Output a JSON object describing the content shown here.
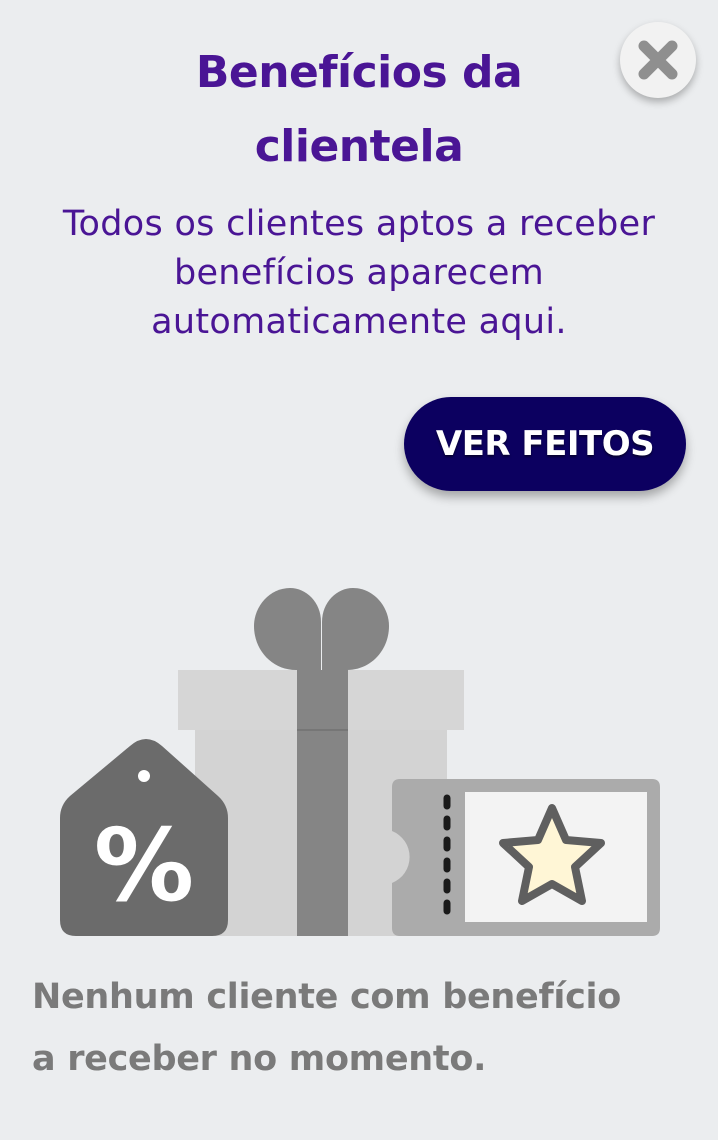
{
  "header": {
    "title_line1": "Benefícios da",
    "title_line2": "clientela",
    "subtitle": "Todos os clientes aptos a receber benefícios aparecem automaticamente aqui."
  },
  "close_button": {
    "icon": "close-icon"
  },
  "action_button": {
    "label": "VER FEITOS"
  },
  "illustration": {
    "icons": [
      "gift-box-icon",
      "discount-tag-icon",
      "star-ticket-icon"
    ],
    "percent_glyph": "%",
    "colors": {
      "gift_light": "#d3d3d3",
      "gift_ribbon": "#858585",
      "tag": "#6b6b6b",
      "ticket_frame": "#ababab",
      "ticket_inner": "#f3f3f3",
      "star_fill": "#fff6d6",
      "star_stroke": "#5f5f5f"
    }
  },
  "empty_state": {
    "line1": "Nenhum cliente com benefício",
    "line2": "a receber no momento."
  },
  "colors": {
    "background": "#ebedef",
    "title": "#4a1595",
    "button": "#0c0060",
    "empty_text": "#7a7a7a"
  }
}
